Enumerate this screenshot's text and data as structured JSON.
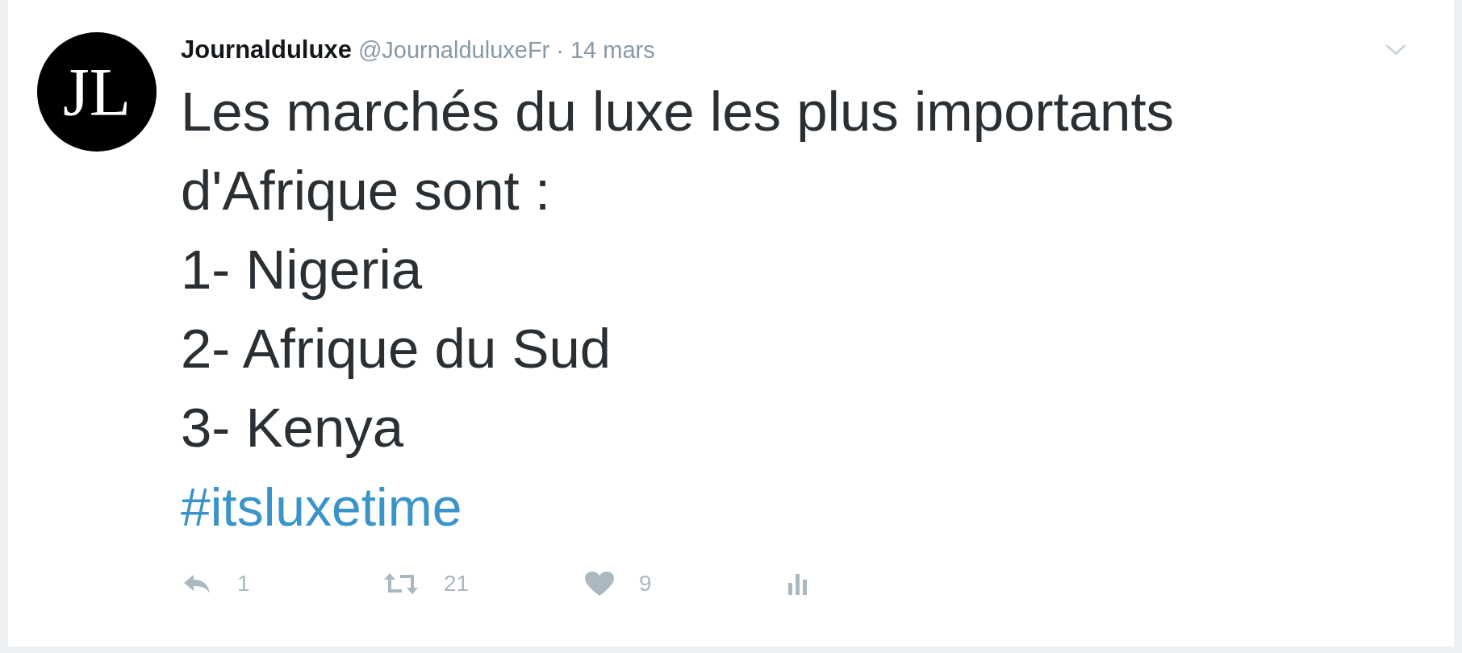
{
  "tweet": {
    "author": "Journalduluxe",
    "handle": "@JournalduluxeFr",
    "separator": "·",
    "date": "14 mars",
    "avatar_initials": "JL",
    "text": "Les marchés du luxe les plus importants\nd'Afrique sont :\n1- Nigeria\n2- Afrique du Sud\n3- Kenya",
    "hashtag": "#itsluxetime",
    "actions": [
      {
        "kind": "reply",
        "count": "1"
      },
      {
        "kind": "retweet",
        "count": "21"
      },
      {
        "kind": "like",
        "count": "9"
      },
      {
        "kind": "analytics"
      }
    ]
  }
}
